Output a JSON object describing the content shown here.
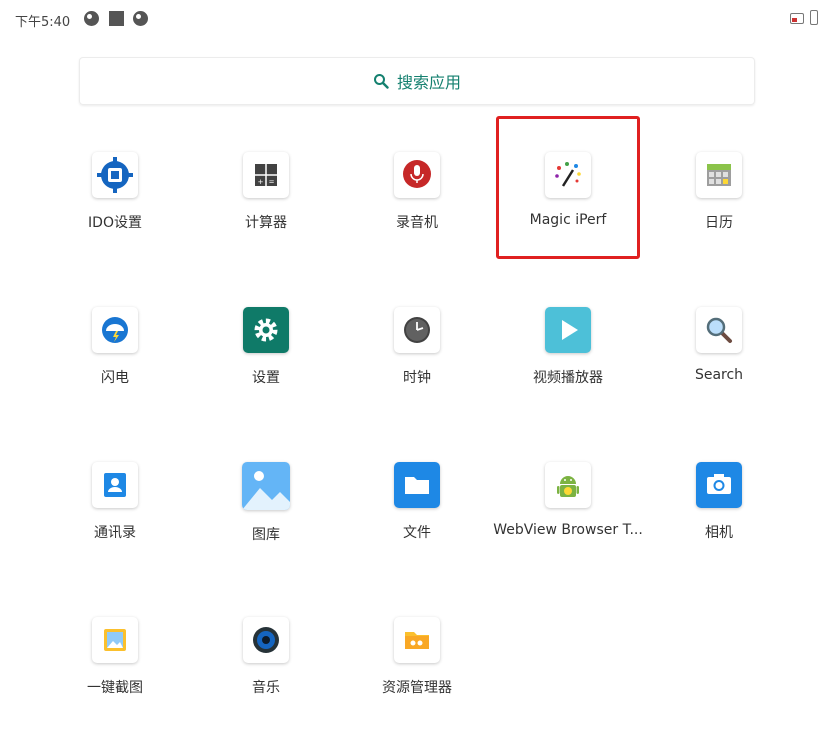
{
  "status": {
    "time": "下午5:40"
  },
  "search": {
    "label": "搜索应用"
  },
  "apps": [
    {
      "label": "IDO设置"
    },
    {
      "label": "计算器"
    },
    {
      "label": "录音机"
    },
    {
      "label": "Magic iPerf"
    },
    {
      "label": "日历"
    },
    {
      "label": "闪电"
    },
    {
      "label": "设置"
    },
    {
      "label": "时钟"
    },
    {
      "label": "视频播放器"
    },
    {
      "label": "Search"
    },
    {
      "label": "通讯录"
    },
    {
      "label": "图库"
    },
    {
      "label": "文件"
    },
    {
      "label": "WebView Browser T..."
    },
    {
      "label": "相机"
    },
    {
      "label": "一键截图"
    },
    {
      "label": "音乐"
    },
    {
      "label": "资源管理器"
    }
  ],
  "colors": {
    "accent": "#14806f",
    "highlight": "#e02020"
  }
}
